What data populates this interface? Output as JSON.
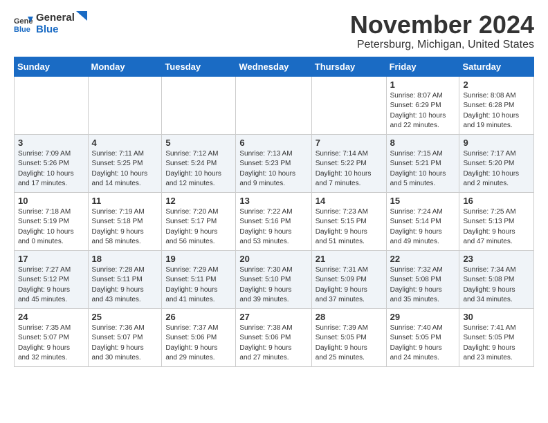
{
  "logo": {
    "general": "General",
    "blue": "Blue"
  },
  "header": {
    "month": "November 2024",
    "location": "Petersburg, Michigan, United States"
  },
  "weekdays": [
    "Sunday",
    "Monday",
    "Tuesday",
    "Wednesday",
    "Thursday",
    "Friday",
    "Saturday"
  ],
  "weeks": [
    [
      {
        "day": "",
        "info": ""
      },
      {
        "day": "",
        "info": ""
      },
      {
        "day": "",
        "info": ""
      },
      {
        "day": "",
        "info": ""
      },
      {
        "day": "",
        "info": ""
      },
      {
        "day": "1",
        "info": "Sunrise: 8:07 AM\nSunset: 6:29 PM\nDaylight: 10 hours\nand 22 minutes."
      },
      {
        "day": "2",
        "info": "Sunrise: 8:08 AM\nSunset: 6:28 PM\nDaylight: 10 hours\nand 19 minutes."
      }
    ],
    [
      {
        "day": "3",
        "info": "Sunrise: 7:09 AM\nSunset: 5:26 PM\nDaylight: 10 hours\nand 17 minutes."
      },
      {
        "day": "4",
        "info": "Sunrise: 7:11 AM\nSunset: 5:25 PM\nDaylight: 10 hours\nand 14 minutes."
      },
      {
        "day": "5",
        "info": "Sunrise: 7:12 AM\nSunset: 5:24 PM\nDaylight: 10 hours\nand 12 minutes."
      },
      {
        "day": "6",
        "info": "Sunrise: 7:13 AM\nSunset: 5:23 PM\nDaylight: 10 hours\nand 9 minutes."
      },
      {
        "day": "7",
        "info": "Sunrise: 7:14 AM\nSunset: 5:22 PM\nDaylight: 10 hours\nand 7 minutes."
      },
      {
        "day": "8",
        "info": "Sunrise: 7:15 AM\nSunset: 5:21 PM\nDaylight: 10 hours\nand 5 minutes."
      },
      {
        "day": "9",
        "info": "Sunrise: 7:17 AM\nSunset: 5:20 PM\nDaylight: 10 hours\nand 2 minutes."
      }
    ],
    [
      {
        "day": "10",
        "info": "Sunrise: 7:18 AM\nSunset: 5:19 PM\nDaylight: 10 hours\nand 0 minutes."
      },
      {
        "day": "11",
        "info": "Sunrise: 7:19 AM\nSunset: 5:18 PM\nDaylight: 9 hours\nand 58 minutes."
      },
      {
        "day": "12",
        "info": "Sunrise: 7:20 AM\nSunset: 5:17 PM\nDaylight: 9 hours\nand 56 minutes."
      },
      {
        "day": "13",
        "info": "Sunrise: 7:22 AM\nSunset: 5:16 PM\nDaylight: 9 hours\nand 53 minutes."
      },
      {
        "day": "14",
        "info": "Sunrise: 7:23 AM\nSunset: 5:15 PM\nDaylight: 9 hours\nand 51 minutes."
      },
      {
        "day": "15",
        "info": "Sunrise: 7:24 AM\nSunset: 5:14 PM\nDaylight: 9 hours\nand 49 minutes."
      },
      {
        "day": "16",
        "info": "Sunrise: 7:25 AM\nSunset: 5:13 PM\nDaylight: 9 hours\nand 47 minutes."
      }
    ],
    [
      {
        "day": "17",
        "info": "Sunrise: 7:27 AM\nSunset: 5:12 PM\nDaylight: 9 hours\nand 45 minutes."
      },
      {
        "day": "18",
        "info": "Sunrise: 7:28 AM\nSunset: 5:11 PM\nDaylight: 9 hours\nand 43 minutes."
      },
      {
        "day": "19",
        "info": "Sunrise: 7:29 AM\nSunset: 5:11 PM\nDaylight: 9 hours\nand 41 minutes."
      },
      {
        "day": "20",
        "info": "Sunrise: 7:30 AM\nSunset: 5:10 PM\nDaylight: 9 hours\nand 39 minutes."
      },
      {
        "day": "21",
        "info": "Sunrise: 7:31 AM\nSunset: 5:09 PM\nDaylight: 9 hours\nand 37 minutes."
      },
      {
        "day": "22",
        "info": "Sunrise: 7:32 AM\nSunset: 5:08 PM\nDaylight: 9 hours\nand 35 minutes."
      },
      {
        "day": "23",
        "info": "Sunrise: 7:34 AM\nSunset: 5:08 PM\nDaylight: 9 hours\nand 34 minutes."
      }
    ],
    [
      {
        "day": "24",
        "info": "Sunrise: 7:35 AM\nSunset: 5:07 PM\nDaylight: 9 hours\nand 32 minutes."
      },
      {
        "day": "25",
        "info": "Sunrise: 7:36 AM\nSunset: 5:07 PM\nDaylight: 9 hours\nand 30 minutes."
      },
      {
        "day": "26",
        "info": "Sunrise: 7:37 AM\nSunset: 5:06 PM\nDaylight: 9 hours\nand 29 minutes."
      },
      {
        "day": "27",
        "info": "Sunrise: 7:38 AM\nSunset: 5:06 PM\nDaylight: 9 hours\nand 27 minutes."
      },
      {
        "day": "28",
        "info": "Sunrise: 7:39 AM\nSunset: 5:05 PM\nDaylight: 9 hours\nand 25 minutes."
      },
      {
        "day": "29",
        "info": "Sunrise: 7:40 AM\nSunset: 5:05 PM\nDaylight: 9 hours\nand 24 minutes."
      },
      {
        "day": "30",
        "info": "Sunrise: 7:41 AM\nSunset: 5:05 PM\nDaylight: 9 hours\nand 23 minutes."
      }
    ]
  ]
}
